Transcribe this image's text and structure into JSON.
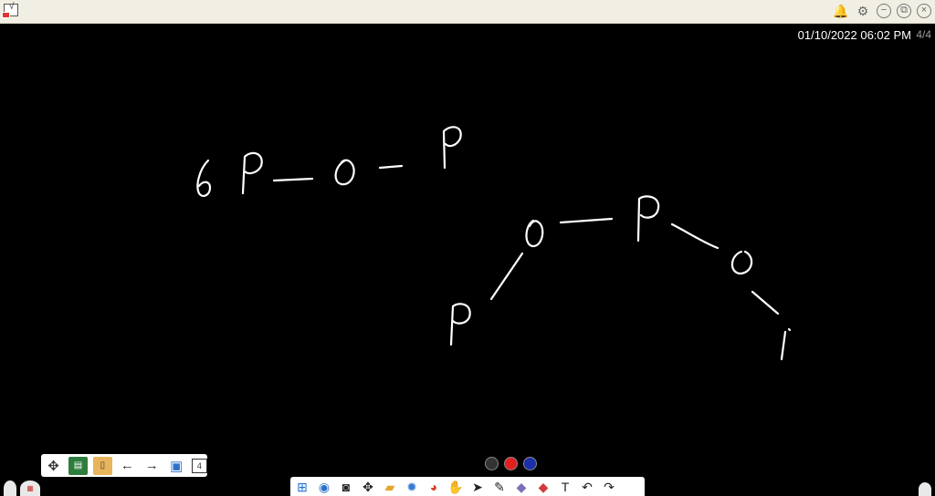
{
  "topbar": {
    "window_controls": [
      "bell-icon",
      "gear-icon",
      "minimize-icon",
      "restore-icon",
      "close-icon"
    ]
  },
  "status": {
    "datetime": "01/10/2022 06:02 PM",
    "page_count": "4/4"
  },
  "board": {
    "strokes": [
      "6P",
      "O",
      "P",
      "O",
      "P",
      "P",
      "O",
      "i"
    ]
  },
  "toolbar": {
    "items": [
      "move-icon",
      "whiteboard-icon",
      "clipboard-icon",
      "arrow-left-icon",
      "arrow-right-icon",
      "add-page-icon",
      "page-number-icon"
    ],
    "page_number": "4"
  },
  "colors": {
    "swatches": [
      "#333333",
      "#e02020",
      "#1a2fa8"
    ]
  },
  "taskbar": {
    "items": [
      "windows-icon",
      "people-icon",
      "camera-icon",
      "move-icon",
      "folder-icon",
      "settings-icon",
      "chrome-icon",
      "hand-icon",
      "pointer-icon",
      "pen-icon",
      "eraser-icon",
      "shapes-icon",
      "text-icon",
      "undo-icon",
      "redo-icon"
    ]
  }
}
